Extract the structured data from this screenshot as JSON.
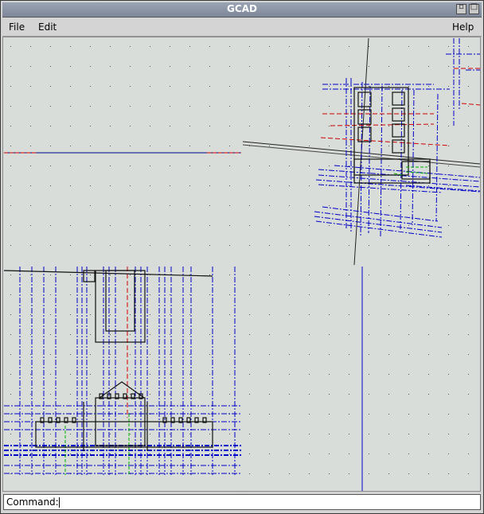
{
  "window": {
    "title": "GCAD"
  },
  "menu": {
    "file": "File",
    "edit": "Edit",
    "help": "Help"
  },
  "title_buttons": {
    "minimize_icon": "minimize-icon",
    "maximize_icon": "maximize-icon"
  },
  "command": {
    "prompt": "Command:",
    "value": ""
  },
  "colors": {
    "background": "#d9ddd9",
    "grid_dot": "#555555",
    "cad_blue": "#0000c8",
    "cad_red": "#d00000",
    "cad_green": "#00c000",
    "cad_black": "#000000"
  }
}
